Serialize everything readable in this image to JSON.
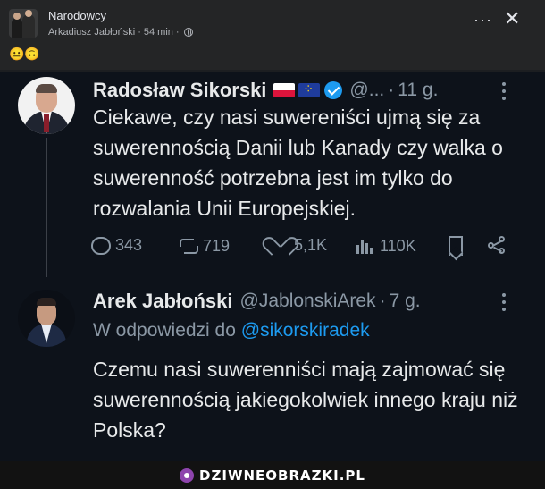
{
  "post": {
    "group_name": "Narodowcy",
    "author": "Arkadiusz Jabłoński",
    "time": "54 min",
    "separator": "·",
    "emoji": "😐🙃",
    "more_label": "···",
    "close_label": "✕"
  },
  "tweet1": {
    "name": "Radosław Sikorski",
    "handle": "@...",
    "separator": "·",
    "time": "11 g.",
    "text": "Ciekawe, czy nasi suwereniści ujmą się za suwerennością Danii lub Kanady czy walka o suwerenność potrzebna jest im tylko do rozwalania Unii Europejskiej.",
    "replies": "343",
    "retweets": "719",
    "likes": "5,1K",
    "views": "110K"
  },
  "tweet2": {
    "name": "Arek Jabłoński",
    "handle": "@JablonskiArek",
    "separator": "·",
    "time": "7 g.",
    "reply_prefix": "W odpowiedzi do",
    "reply_mention": "@sikorskiradek",
    "text": "Czemu nasi suwerenniści mają zajmować się suwerennością jakiegokolwiek innego kraju niż Polska?"
  },
  "footer": {
    "watermark": "DZIWNEOBRAZKI.PL"
  },
  "colors": {
    "fb_bg": "#242526",
    "tweet_bg": "#0d121a",
    "link": "#1d9bf0",
    "muted": "#8b98a5"
  },
  "icons": [
    "more-icon",
    "close-icon",
    "globe-icon",
    "verified-icon",
    "flag-pl-icon",
    "flag-eu-icon",
    "reply-icon",
    "retweet-icon",
    "like-icon",
    "views-icon",
    "bookmark-icon",
    "share-icon",
    "watermark-icon"
  ]
}
